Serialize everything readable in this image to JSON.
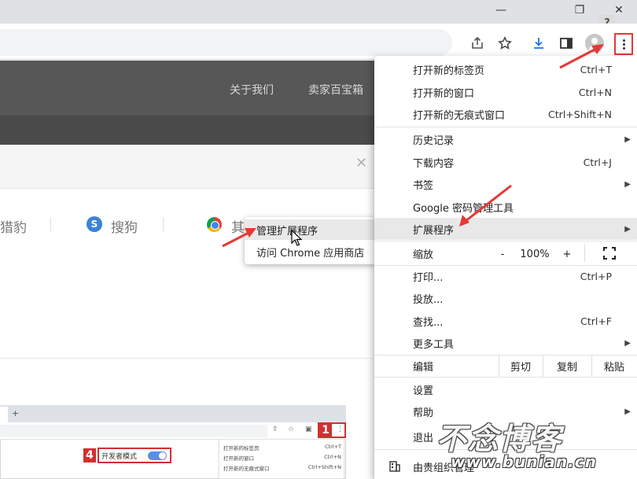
{
  "window": {
    "minimize": "—",
    "restore": "❐",
    "close": "✕",
    "help_badge": "?"
  },
  "background": {
    "nav": [
      "关于我们",
      "卖家百宝箱"
    ],
    "close_glyph": "✕",
    "engines": [
      "猎豹",
      "搜狗",
      "其"
    ],
    "sogou_glyph": "S"
  },
  "mini": {
    "plus": "+",
    "badge1": "1",
    "badge4": "4",
    "dev_mode": "开发者模式",
    "menu_rows": [
      {
        "label": "打开新的标签页",
        "shortcut": "Ctrl+T"
      },
      {
        "label": "打开新的窗口",
        "shortcut": "Ctrl+N"
      },
      {
        "label": "打开新的无痕式窗口",
        "shortcut": "Ctrl+Shift+N"
      }
    ]
  },
  "submenu": {
    "items": [
      "管理扩展程序",
      "访问 Chrome 应用商店"
    ]
  },
  "menu": {
    "items": [
      {
        "label": "打开新的标签页",
        "shortcut": "Ctrl+T"
      },
      {
        "label": "打开新的窗口",
        "shortcut": "Ctrl+N"
      },
      {
        "label": "打开新的无痕式窗口",
        "shortcut": "Ctrl+Shift+N"
      },
      {
        "label": "历史记录",
        "shortcut": ""
      },
      {
        "label": "下载内容",
        "shortcut": "Ctrl+J"
      },
      {
        "label": "书签",
        "shortcut": ""
      },
      {
        "label": "Google 密码管理工具",
        "shortcut": ""
      },
      {
        "label": "扩展程序",
        "shortcut": ""
      },
      {
        "label": "缩放",
        "shortcut": ""
      },
      {
        "label": "打印...",
        "shortcut": "Ctrl+P"
      },
      {
        "label": "投放...",
        "shortcut": ""
      },
      {
        "label": "查找...",
        "shortcut": "Ctrl+F"
      },
      {
        "label": "更多工具",
        "shortcut": ""
      },
      {
        "label": "编辑",
        "shortcut": ""
      },
      {
        "label": "设置",
        "shortcut": ""
      },
      {
        "label": "帮助",
        "shortcut": ""
      },
      {
        "label": "退出",
        "shortcut": ""
      },
      {
        "label": "由贵组织管理",
        "shortcut": ""
      }
    ],
    "zoom": {
      "minus": "-",
      "value": "100%",
      "plus": "+"
    },
    "edit": {
      "cut": "剪切",
      "copy": "复制",
      "paste": "粘贴"
    },
    "arrow_glyph": "▶"
  },
  "watermark": {
    "title": "不念博客",
    "url": "www.bunian.cn"
  },
  "colors": {
    "annotation_red": "#e53935",
    "menu_highlight": "#e8e8e8",
    "toggle_blue": "#5b8def"
  }
}
